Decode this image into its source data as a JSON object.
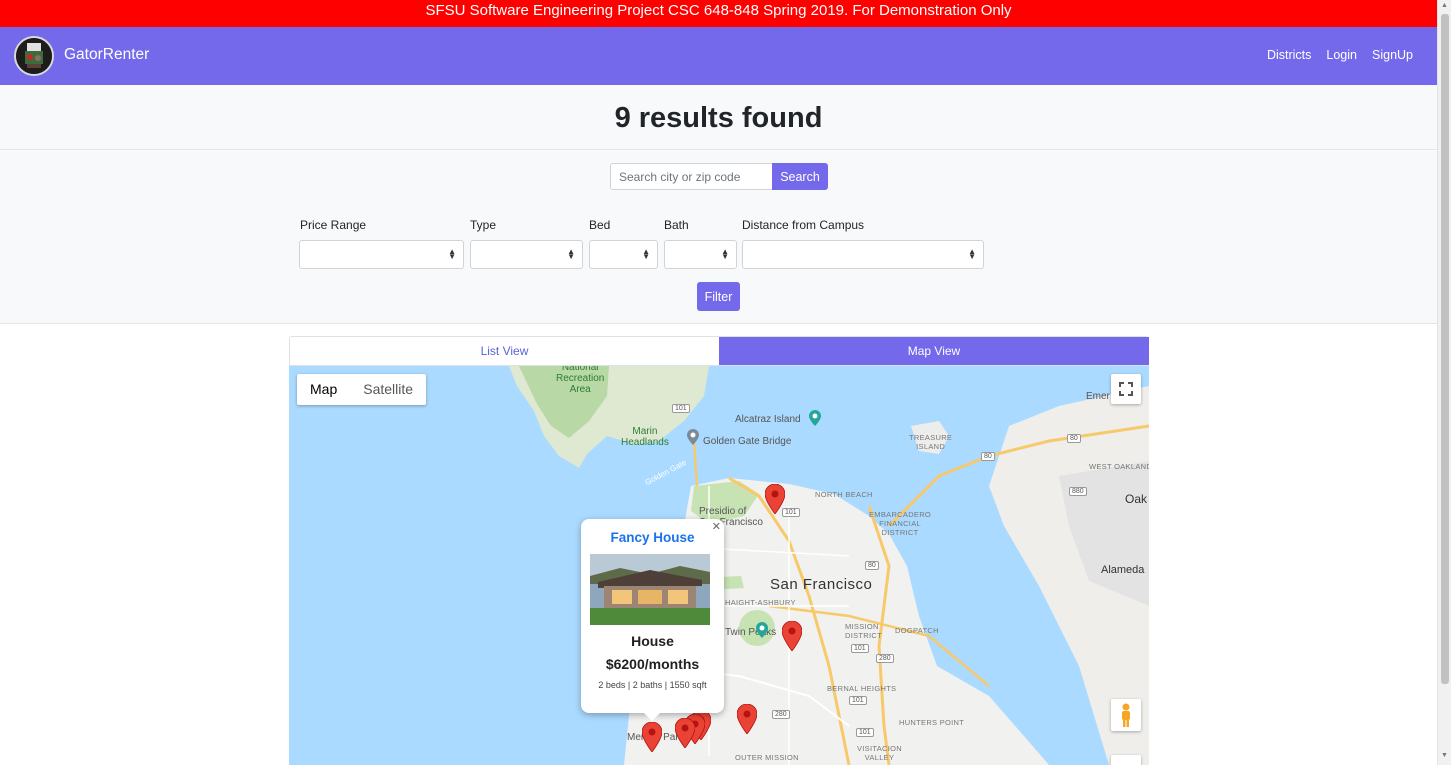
{
  "banner": {
    "text": "SFSU Software Engineering Project CSC 648-848 Spring 2019. For Demonstration Only"
  },
  "navbar": {
    "brand": "GatorRenter",
    "logo_icon": "gator-logo-icon",
    "links": [
      "Districts",
      "Login",
      "SignUp"
    ]
  },
  "results": {
    "title": "9 results found"
  },
  "search": {
    "placeholder": "Search city or zip code",
    "value": "",
    "button": "Search"
  },
  "filters": {
    "price_label": "Price Range",
    "type_label": "Type",
    "bed_label": "Bed",
    "bath_label": "Bath",
    "distance_label": "Distance from Campus",
    "button": "Filter"
  },
  "tabs": {
    "list": "List View",
    "map": "Map View",
    "active": "map"
  },
  "map": {
    "type_options": [
      "Map",
      "Satellite"
    ],
    "active_type": "Map",
    "labels": {
      "recreation": "National\nRecreation\nArea",
      "marin": "Marin\nHeadlands",
      "golden_gate_bridge": "Golden Gate Bridge",
      "golden_gate": "Golden Gate",
      "alcatraz": "Alcatraz Island",
      "treasure_island": "TREASURE\nISLAND",
      "north_beach": "NORTH BEACH",
      "embarcadero": "EMBARCADERO\nFINANCIAL\nDISTRICT",
      "presidio": "Presidio of\nSan Francisco",
      "san_francisco": "San Francisco",
      "haight": "HAIGHT-ASHBURY",
      "peaks": "Twin Peaks",
      "mission": "MISSION\nDISTRICT",
      "dogpatch": "DOGPATCH",
      "bernal": "BERNAL HEIGHTS",
      "hunters": "HUNTERS POINT",
      "visitacion": "VISITACION\nVALLEY",
      "outer_mission": "OUTER MISSION",
      "oakland": "Oak",
      "west_oakland": "WEST OAKLAND",
      "alameda": "Alameda",
      "emeryville": "Emer",
      "merced": "Merced Park"
    },
    "highways": [
      "101",
      "101",
      "80",
      "80",
      "880",
      "101",
      "80",
      "280",
      "101",
      "101",
      "280"
    ]
  },
  "infowindow": {
    "title": "Fancy House",
    "type": "House",
    "price": "$6200/months",
    "details": "2 beds | 2 baths | 1550 sqft"
  },
  "colors": {
    "brand": "#7469ea",
    "banner": "#ff0000",
    "pin": "#ea4335",
    "water": "#aadaff"
  }
}
